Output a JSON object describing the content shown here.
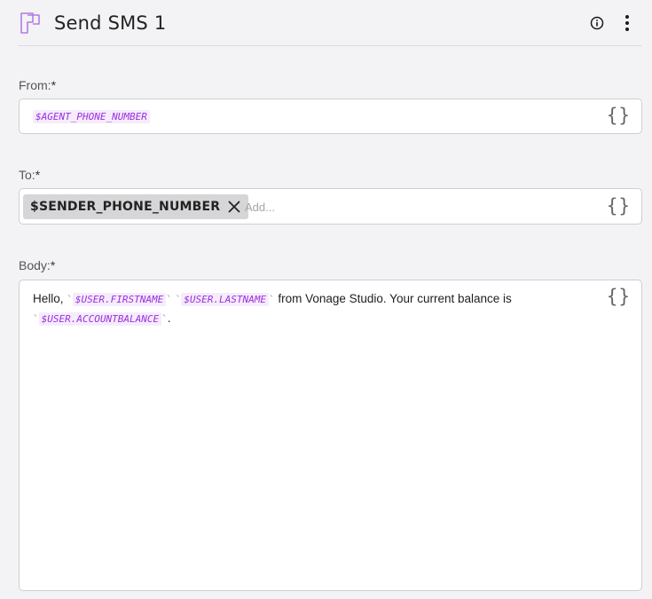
{
  "header": {
    "title": "Send SMS 1",
    "icon": "sms-node-icon",
    "actions": [
      "info-icon",
      "more-vertical-icon"
    ]
  },
  "from": {
    "label": "From:",
    "required_mark": "*",
    "value": "$AGENT_PHONE_NUMBER",
    "variable_button": "{}"
  },
  "to": {
    "label": "To:",
    "required_mark": "*",
    "chips": [
      "$SENDER_PHONE_NUMBER"
    ],
    "placeholder": "Add...",
    "variable_button": "{}"
  },
  "body": {
    "label": "Body:",
    "required_mark": "*",
    "text_start": "Hello, ",
    "var_firstname": "$USER.FIRSTNAME",
    "var_lastname": "$USER.LASTNAME",
    "text_middle": " from Vonage Studio. Your current balance is",
    "var_balance": "$USER.ACCOUNTBALANCE",
    "text_end": ".",
    "backtick": "`",
    "variable_button": "{}"
  },
  "colors": {
    "accent": "#9a2fe0",
    "icon_purple": "#b57be6",
    "background": "#f3f3f5"
  }
}
